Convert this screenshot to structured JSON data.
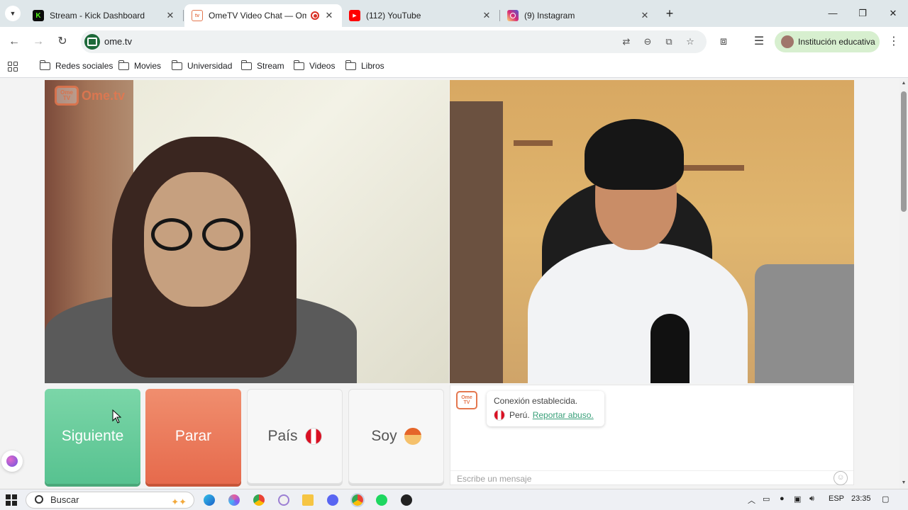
{
  "tabs": [
    {
      "title": "Stream - Kick Dashboard",
      "favicon": "kick-icon",
      "color": "#53fc18"
    },
    {
      "title": "OmeTV Video Chat — Ome",
      "favicon": "ometv-icon",
      "color": "#e4774f",
      "active": true
    },
    {
      "title": "(112) YouTube",
      "favicon": "youtube-icon",
      "color": "#ff0000"
    },
    {
      "title": "(9) Instagram",
      "favicon": "instagram-icon",
      "color": "#d62976"
    }
  ],
  "toolbar": {
    "url": "ome.tv",
    "profile_name": "Institución educativa"
  },
  "bookmarks": [
    "Redes sociales",
    "Movies",
    "Universidad",
    "Stream",
    "Videos",
    "Libros"
  ],
  "ome": {
    "logo_text": "Ome.tv",
    "logo_tv_top": "Ome",
    "logo_tv_bottom": "TV"
  },
  "buttons": {
    "next": "Siguiente",
    "stop": "Parar",
    "country": "País",
    "gender": "Soy"
  },
  "chat": {
    "status": "Conexión establecida.",
    "country": "Perú.",
    "report": "Reportar abuso.",
    "input_placeholder": "Escribe un mensaje"
  },
  "taskbar": {
    "search": "Buscar",
    "lang": "ESP",
    "time": "23:35"
  },
  "colors": {
    "next_button": "#5ec796",
    "stop_button": "#e8704f",
    "accent": "#e4774f"
  }
}
